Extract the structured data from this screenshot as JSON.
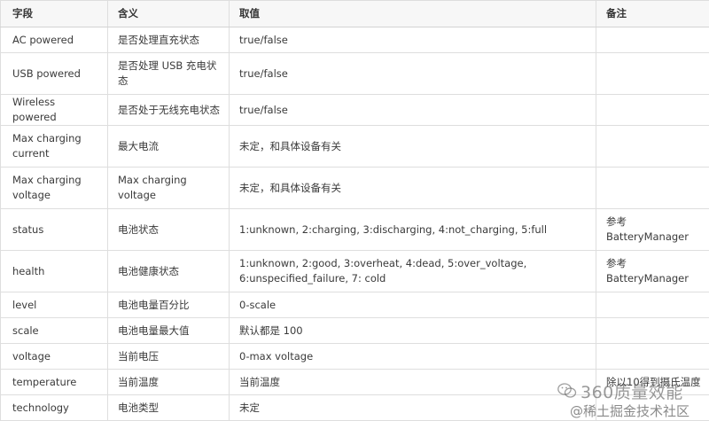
{
  "table": {
    "headers": [
      "字段",
      "含义",
      "取值",
      "备注"
    ],
    "rows": [
      {
        "field": "AC powered",
        "meaning": "是否处理直充状态",
        "value": "true/false",
        "note": ""
      },
      {
        "field": "USB powered",
        "meaning": "是否处理 USB 充电状态",
        "value": "true/false",
        "note": ""
      },
      {
        "field": "Wireless powered",
        "meaning": "是否处于无线充电状态",
        "value": "true/false",
        "note": ""
      },
      {
        "field": "Max charging current",
        "meaning": "最大电流",
        "value": "未定，和具体设备有关",
        "note": ""
      },
      {
        "field": "Max charging voltage",
        "meaning": "Max charging voltage",
        "value": "未定，和具体设备有关",
        "note": ""
      },
      {
        "field": "status",
        "meaning": "电池状态",
        "value": "1:unknown, 2:charging, 3:discharging, 4:not_charging, 5:full",
        "note": "参考 BatteryManager"
      },
      {
        "field": "health",
        "meaning": "电池健康状态",
        "value": "1:unknown, 2:good, 3:overheat, 4:dead, 5:over_voltage, 6:unspecified_failure, 7: cold",
        "note": "参考 BatteryManager"
      },
      {
        "field": "level",
        "meaning": "电池电量百分比",
        "value": "0-scale",
        "note": ""
      },
      {
        "field": "scale",
        "meaning": "电池电量最大值",
        "value": "默认都是 100",
        "note": ""
      },
      {
        "field": "voltage",
        "meaning": "当前电压",
        "value": "0-max voltage",
        "note": ""
      },
      {
        "field": "temperature",
        "meaning": "当前温度",
        "value": "当前温度",
        "note": "除以10得到摄氏温度"
      },
      {
        "field": "technology",
        "meaning": "电池类型",
        "value": "未定",
        "note": ""
      }
    ]
  },
  "watermark": {
    "line1": "360质量效能",
    "line2": "@稀土掘金技术社区",
    "icon": "wechat-icon"
  }
}
